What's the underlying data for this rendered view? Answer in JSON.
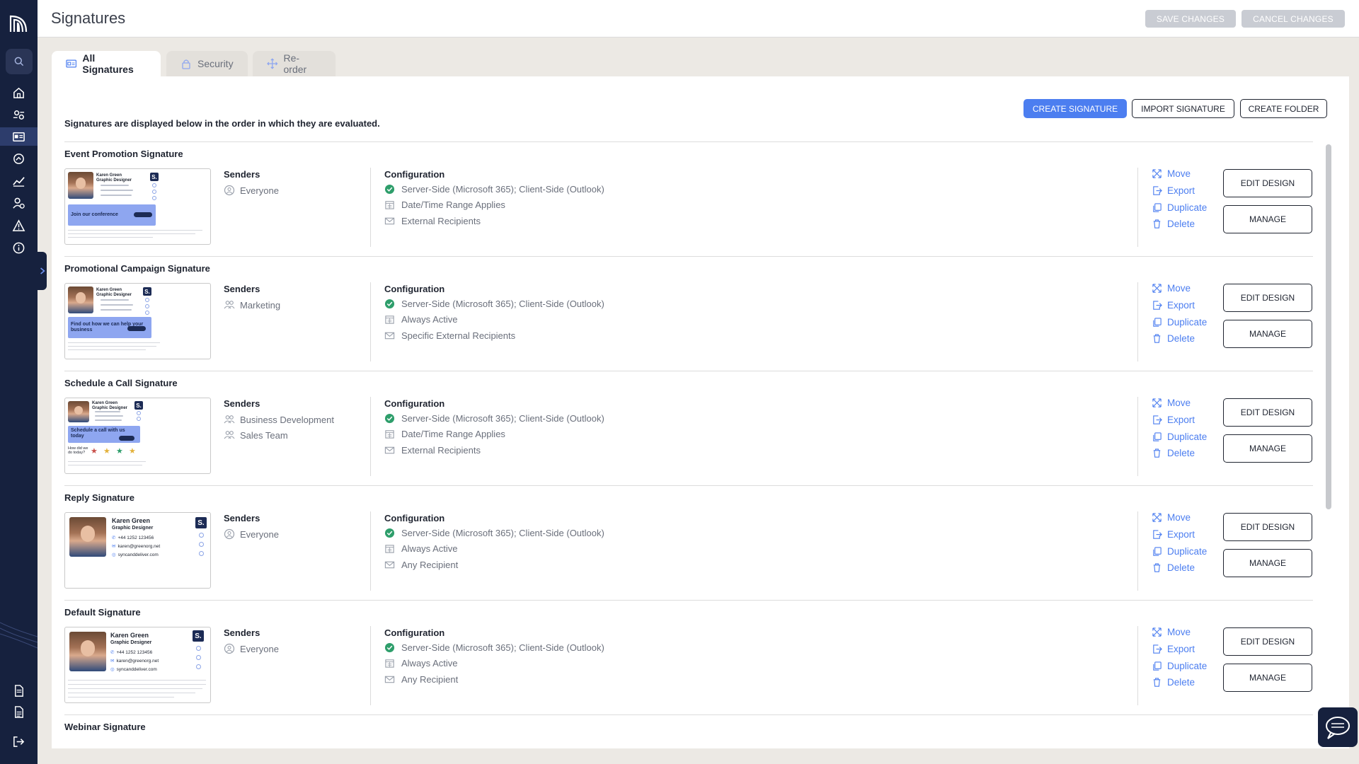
{
  "header": {
    "title": "Signatures",
    "save_label": "SAVE CHANGES",
    "cancel_label": "CANCEL CHANGES"
  },
  "tabs": [
    {
      "label": "All Signatures",
      "icon": "id-card-icon",
      "active": true
    },
    {
      "label": "Security",
      "icon": "lock-icon",
      "active": false
    },
    {
      "label": "Re-order",
      "icon": "move-icon",
      "active": false
    }
  ],
  "toolbar": {
    "intro": "Signatures are displayed below in the order in which they are evaluated.",
    "create_label": "CREATE SIGNATURE",
    "import_label": "IMPORT SIGNATURE",
    "folder_label": "CREATE FOLDER"
  },
  "labels": {
    "senders": "Senders",
    "configuration": "Configuration",
    "move": "Move",
    "export": "Export",
    "duplicate": "Duplicate",
    "delete": "Delete",
    "edit_design": "EDIT DESIGN",
    "manage": "MANAGE"
  },
  "signatures": [
    {
      "name": "Event Promotion Signature",
      "senders": [
        "Everyone"
      ],
      "config": [
        "Server-Side (Microsoft 365); Client-Side (Outlook)",
        "Date/Time Range Applies",
        "External Recipients"
      ],
      "banner": "Join our conference"
    },
    {
      "name": "Promotional Campaign Signature",
      "senders": [
        "Marketing"
      ],
      "config": [
        "Server-Side (Microsoft 365); Client-Side (Outlook)",
        "Always Active",
        "Specific External Recipients"
      ],
      "banner": "Find out how we can help your business"
    },
    {
      "name": "Schedule a Call Signature",
      "senders": [
        "Business Development",
        "Sales Team"
      ],
      "config": [
        "Server-Side (Microsoft 365); Client-Side (Outlook)",
        "Date/Time Range Applies",
        "External Recipients"
      ],
      "banner": "Schedule a call with us today"
    },
    {
      "name": "Reply Signature",
      "senders": [
        "Everyone"
      ],
      "config": [
        "Server-Side (Microsoft 365); Client-Side (Outlook)",
        "Always Active",
        "Any Recipient"
      ],
      "card": {
        "name": "Karen Green",
        "title": "Graphic Designer",
        "phone": "+44 1252 123456",
        "email": "karen@greenorg.net",
        "web": "syncanddeliver.com"
      }
    },
    {
      "name": "Default Signature",
      "senders": [
        "Everyone"
      ],
      "config": [
        "Server-Side (Microsoft 365); Client-Side (Outlook)",
        "Always Active",
        "Any Recipient"
      ],
      "card": {
        "name": "Karen Green",
        "title": "Graphic Designer",
        "phone": "+44 1252 123456",
        "email": "karen@greenorg.net",
        "web": "syncanddeliver.com"
      }
    }
  ],
  "next_partial": "Webinar Signature",
  "colors": {
    "sidebar": "#16213e",
    "accent": "#4c7ef0",
    "success": "#2e9e6b",
    "disabled": "#c9ccd3"
  }
}
